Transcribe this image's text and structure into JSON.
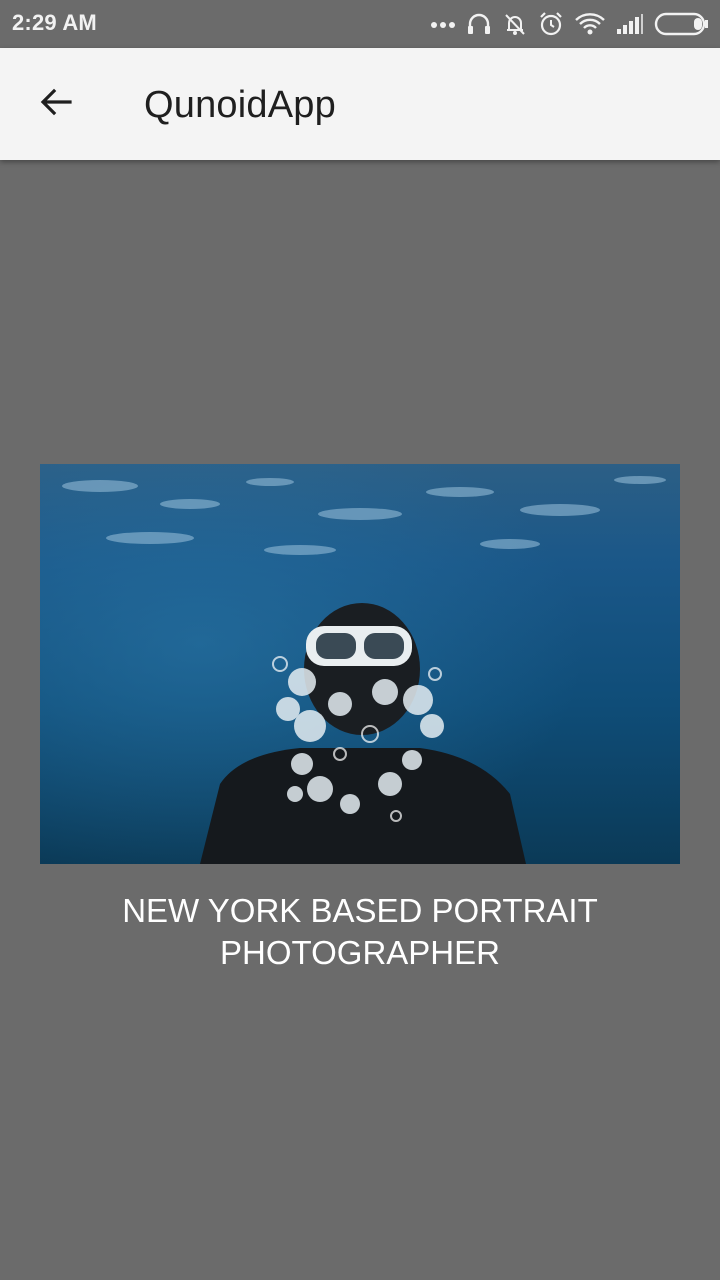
{
  "status_bar": {
    "time": "2:29 AM",
    "icons": [
      "more-icon",
      "headset-icon",
      "notifications-off-icon",
      "alarm-icon",
      "wifi-icon",
      "signal-icon",
      "battery-icon"
    ]
  },
  "app_bar": {
    "title": "QunoidApp",
    "back_icon": "arrow-left-icon"
  },
  "content": {
    "image_subject": "underwater-diver-photo",
    "caption": "NEW YORK BASED PORTRAIT PHOTOGRAPHER"
  },
  "colors": {
    "background": "#6b6b6b",
    "app_bar": "#f4f4f4",
    "title_text": "#1f1f1f",
    "caption_text": "#ffffff",
    "water": "#10466f"
  }
}
